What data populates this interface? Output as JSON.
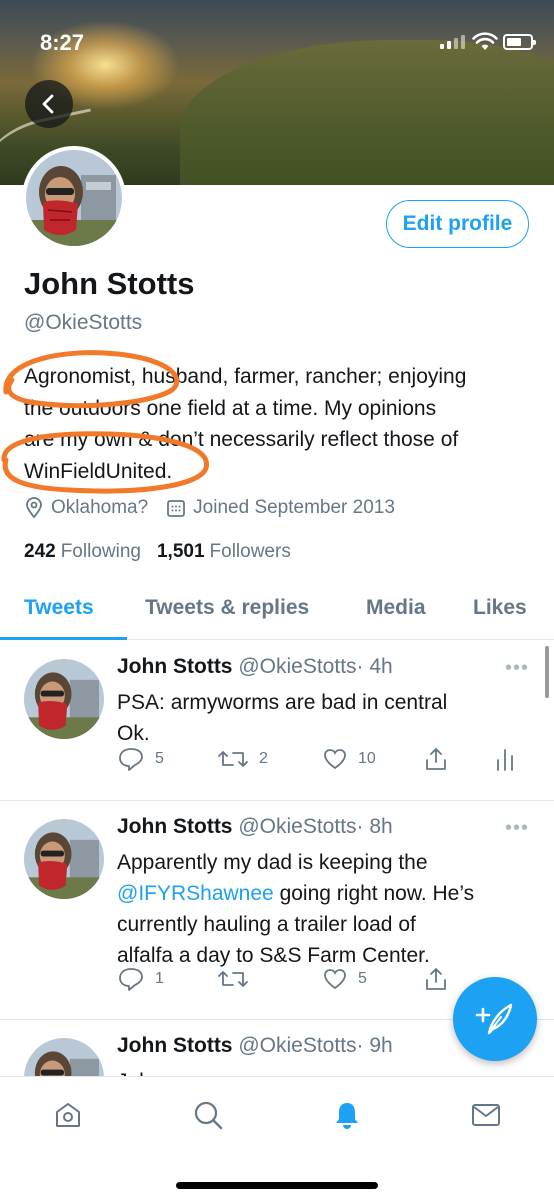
{
  "status_bar": {
    "time": "8:27"
  },
  "profile": {
    "edit_button": "Edit profile",
    "name": "John Stotts",
    "handle": "@OkieStotts",
    "bio_lines": [
      "Agronomist, husband, farmer, rancher; enjoying",
      "the outdoors one field at a time. My opinions",
      "are my own & don’t necessarily reflect those of",
      "WinFieldUnited."
    ],
    "location": "Oklahoma?",
    "joined": "Joined September 2013",
    "following_count": "242",
    "following_label": "Following",
    "followers_count": "1,501",
    "followers_label": "Followers"
  },
  "tabs": [
    {
      "label": "Tweets",
      "active": true
    },
    {
      "label": "Tweets & replies",
      "active": false
    },
    {
      "label": "Media",
      "active": false
    },
    {
      "label": "Likes",
      "active": false
    }
  ],
  "tweets": [
    {
      "name": "John Stotts",
      "handle": "@OkieStotts",
      "time": "· 4h",
      "text_lines": [
        "PSA: armyworms are bad in central",
        "Ok."
      ],
      "replies": "5",
      "retweets": "2",
      "likes": "10"
    },
    {
      "name": "John Stotts",
      "handle": "@OkieStotts",
      "time": "· 8h",
      "text_line1": "Apparently my dad is keeping the",
      "mention": "@IFYRShawnee",
      "text_line2_rest": " going right now.  He’s",
      "text_line3": "currently hauling a trailer load of",
      "text_line4": "alfalfa a day to S&S Farm Center.",
      "replies": "1",
      "retweets": "",
      "likes": "5"
    },
    {
      "name": "John Stotts",
      "handle": "@OkieStotts",
      "time": "· 9h",
      "text_partial": "July corn:"
    }
  ],
  "colors": {
    "accent": "#1da1f2",
    "secondary_text": "#657786",
    "annotation": "#f2782a"
  },
  "icons": [
    "back-icon",
    "location-icon",
    "calendar-icon",
    "reply-icon",
    "retweet-icon",
    "like-icon",
    "share-icon",
    "analytics-icon",
    "more-icon",
    "compose-icon",
    "home-icon",
    "search-icon",
    "notifications-icon",
    "messages-icon"
  ]
}
